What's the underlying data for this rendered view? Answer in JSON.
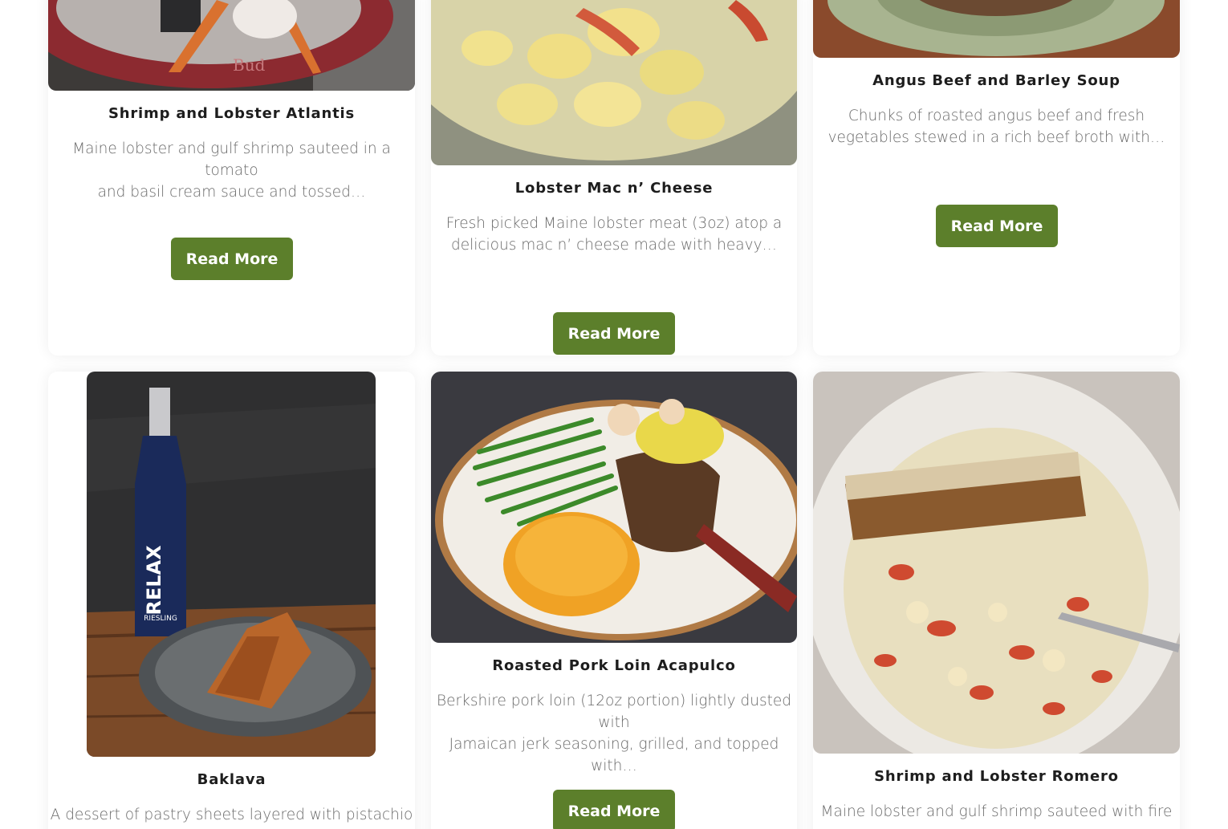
{
  "menu_items": [
    {
      "title": "Shrimp and Lobster Atlantis",
      "description_line1": "Maine lobster and gulf shrimp sauteed in a tomato",
      "description_line2": "and basil cream sauce and tossed…",
      "button_label": "Read More"
    },
    {
      "title": "Lobster Mac n’ Cheese",
      "description_line1": "Fresh picked Maine lobster meat (3oz) atop a",
      "description_line2": "delicious mac n’ cheese made with heavy…",
      "button_label": "Read More"
    },
    {
      "title": "Angus Beef and Barley Soup",
      "description_line1": "Chunks of roasted angus beef and fresh",
      "description_line2": "vegetables stewed in a rich beef broth with…",
      "button_label": "Read More"
    },
    {
      "title": "Baklava",
      "description_line1": "A dessert of pastry sheets layered with pistachio",
      "description_line2": "",
      "photo_text": "RELAX",
      "photo_subtext": "RIESLING"
    },
    {
      "title": "Roasted Pork Loin Acapulco",
      "description_line1": "Berkshire pork loin (12oz portion) lightly dusted with",
      "description_line2": "Jamaican jerk seasoning, grilled, and topped with…",
      "button_label": "Read More"
    },
    {
      "title": "Shrimp and Lobster Romero",
      "description_line1": "Maine lobster and gulf shrimp sauteed with fire",
      "description_line2": ""
    }
  ],
  "colors": {
    "button_bg": "#5c7f2b",
    "button_text": "#ffffff",
    "title": "#1d1d1d",
    "text": "#6a6a6a"
  },
  "icons": [
    "food-photo"
  ]
}
